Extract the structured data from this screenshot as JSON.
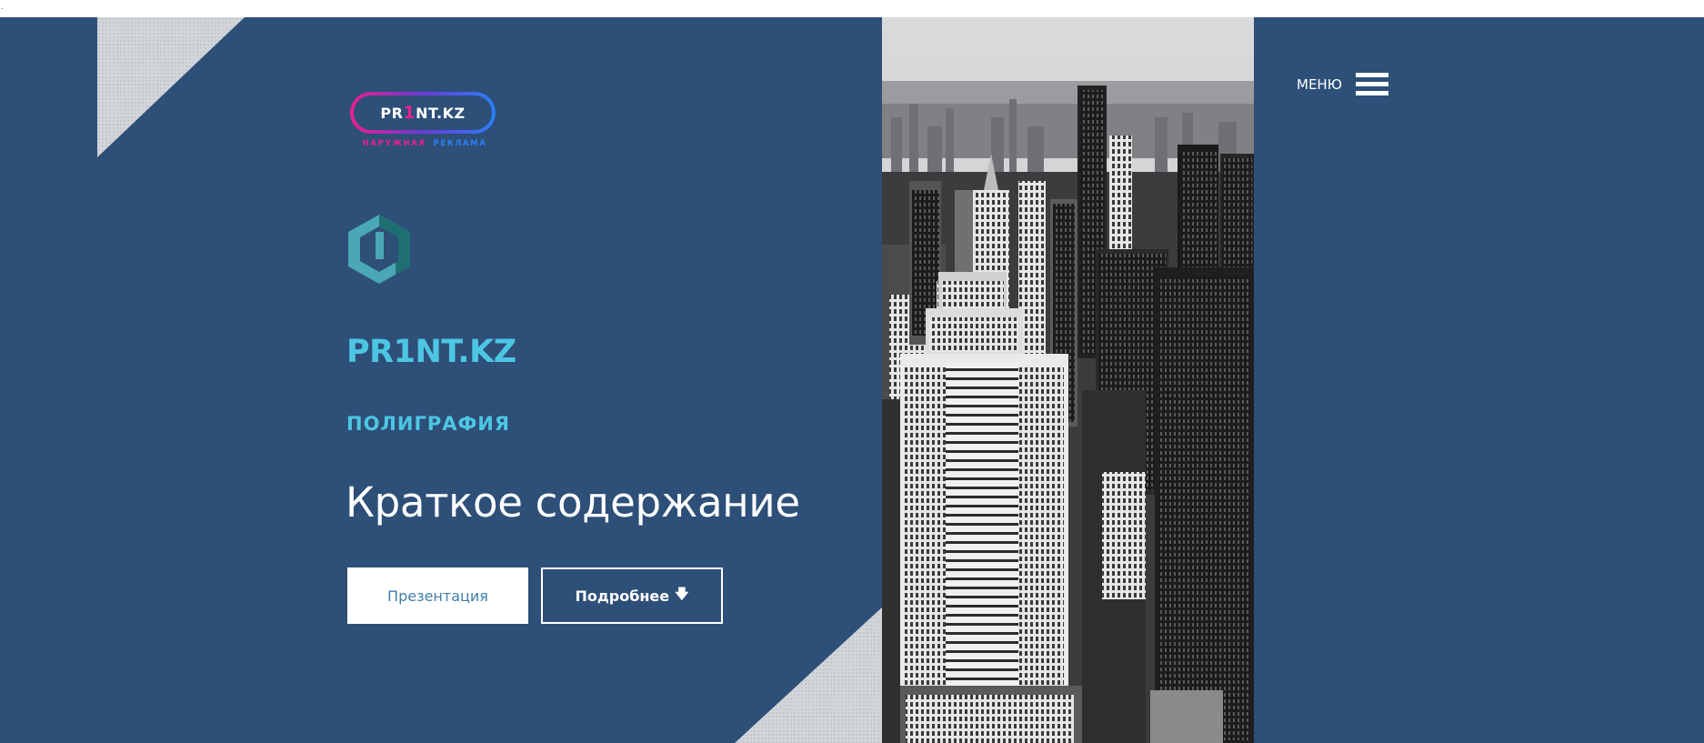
{
  "topbar": {
    "marker": "."
  },
  "logo": {
    "text_pre": "PR",
    "text_one": "1",
    "text_post": "NT.KZ",
    "tagline_1": "НАРУЖНАЯ",
    "tagline_2": "РЕКЛАМА"
  },
  "brand": {
    "icon": "hexagon-logo-icon",
    "title": "PR1NT.KZ",
    "subtitle": "ПОЛИГРАФИЯ"
  },
  "hero": {
    "headline": "Краткое содержание",
    "background_image": "black-and-white city skyline"
  },
  "buttons": {
    "presentation_label": "Презентация",
    "more_label": "Подробнее",
    "more_icon": "arrow-down-icon"
  },
  "menu": {
    "label": "МЕНЮ",
    "icon": "hamburger-menu-icon"
  },
  "colors": {
    "background": "#2d4f78",
    "accent_cyan": "#4dc6e3",
    "logo_pink": "#e8208f",
    "logo_blue": "#2c7ff7",
    "button_text": "#3f7fa8"
  }
}
